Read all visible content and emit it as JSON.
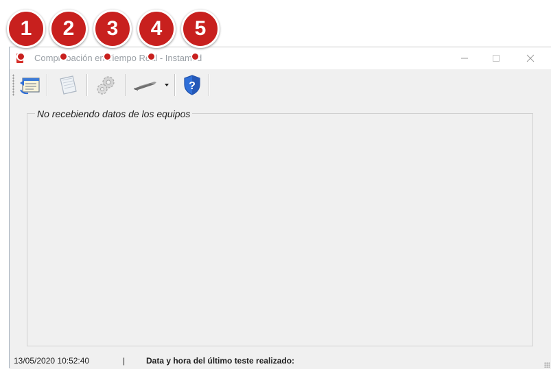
{
  "window": {
    "title": "Comprobación en Tiempo Real - Instamed"
  },
  "toolbar": {
    "buttons": [
      {
        "icon": "report-icon"
      },
      {
        "icon": "document-icon"
      },
      {
        "icon": "settings-gears-icon"
      },
      {
        "icon": "usb-device-icon"
      },
      {
        "icon": "help-shield-icon"
      }
    ]
  },
  "group": {
    "label": "No recebiendo datos de los equipos"
  },
  "status": {
    "datetime": "13/05/2020 10:52:40",
    "separator": "|",
    "text": "Data y hora del último teste realizado:"
  },
  "callouts": [
    "1",
    "2",
    "3",
    "4",
    "5"
  ],
  "colors": {
    "callout": "#c8201e",
    "app_icon": "#d6302a",
    "help_icon": "#2f6fd8"
  }
}
